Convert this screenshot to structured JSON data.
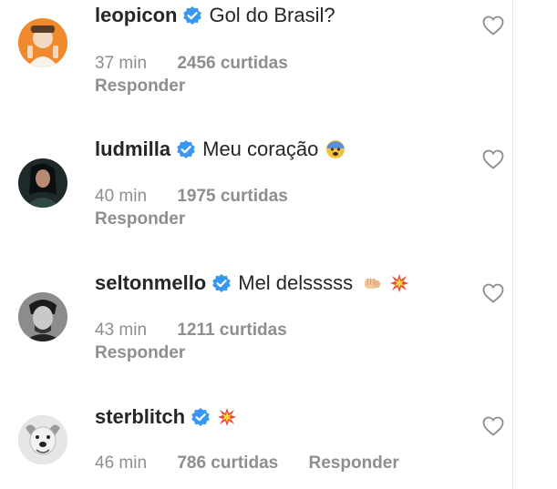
{
  "comments": [
    {
      "username": "leopicon",
      "text": "Gol do Brasil?",
      "time": "37 min",
      "likes": "2456 curtidas",
      "reply": "Responder",
      "avatar": "avatar-orange",
      "emojis": []
    },
    {
      "username": "ludmilla",
      "text": "Meu coração",
      "time": "40 min",
      "likes": "1975 curtidas",
      "reply": "Responder",
      "avatar": "avatar-dark",
      "emojis": [
        "anxious-face-emoji"
      ]
    },
    {
      "username": "seltonmello",
      "text": "Mel delsssss",
      "time": "43 min",
      "likes": "1211 curtidas",
      "reply": "Responder",
      "avatar": "avatar-gray",
      "emojis": [
        "fist-emoji",
        "collision-emoji"
      ]
    },
    {
      "username": "sterblitch",
      "text": "",
      "time": "46 min",
      "likes": "786 curtidas",
      "reply": "Responder",
      "avatar": "avatar-dog",
      "emojis": [
        "collision-emoji"
      ]
    }
  ],
  "colors": {
    "verified": "#3897f0",
    "meta": "#8e8e8e",
    "text": "#262626"
  },
  "icons": [
    "verified-badge-icon",
    "heart-outline-icon"
  ]
}
